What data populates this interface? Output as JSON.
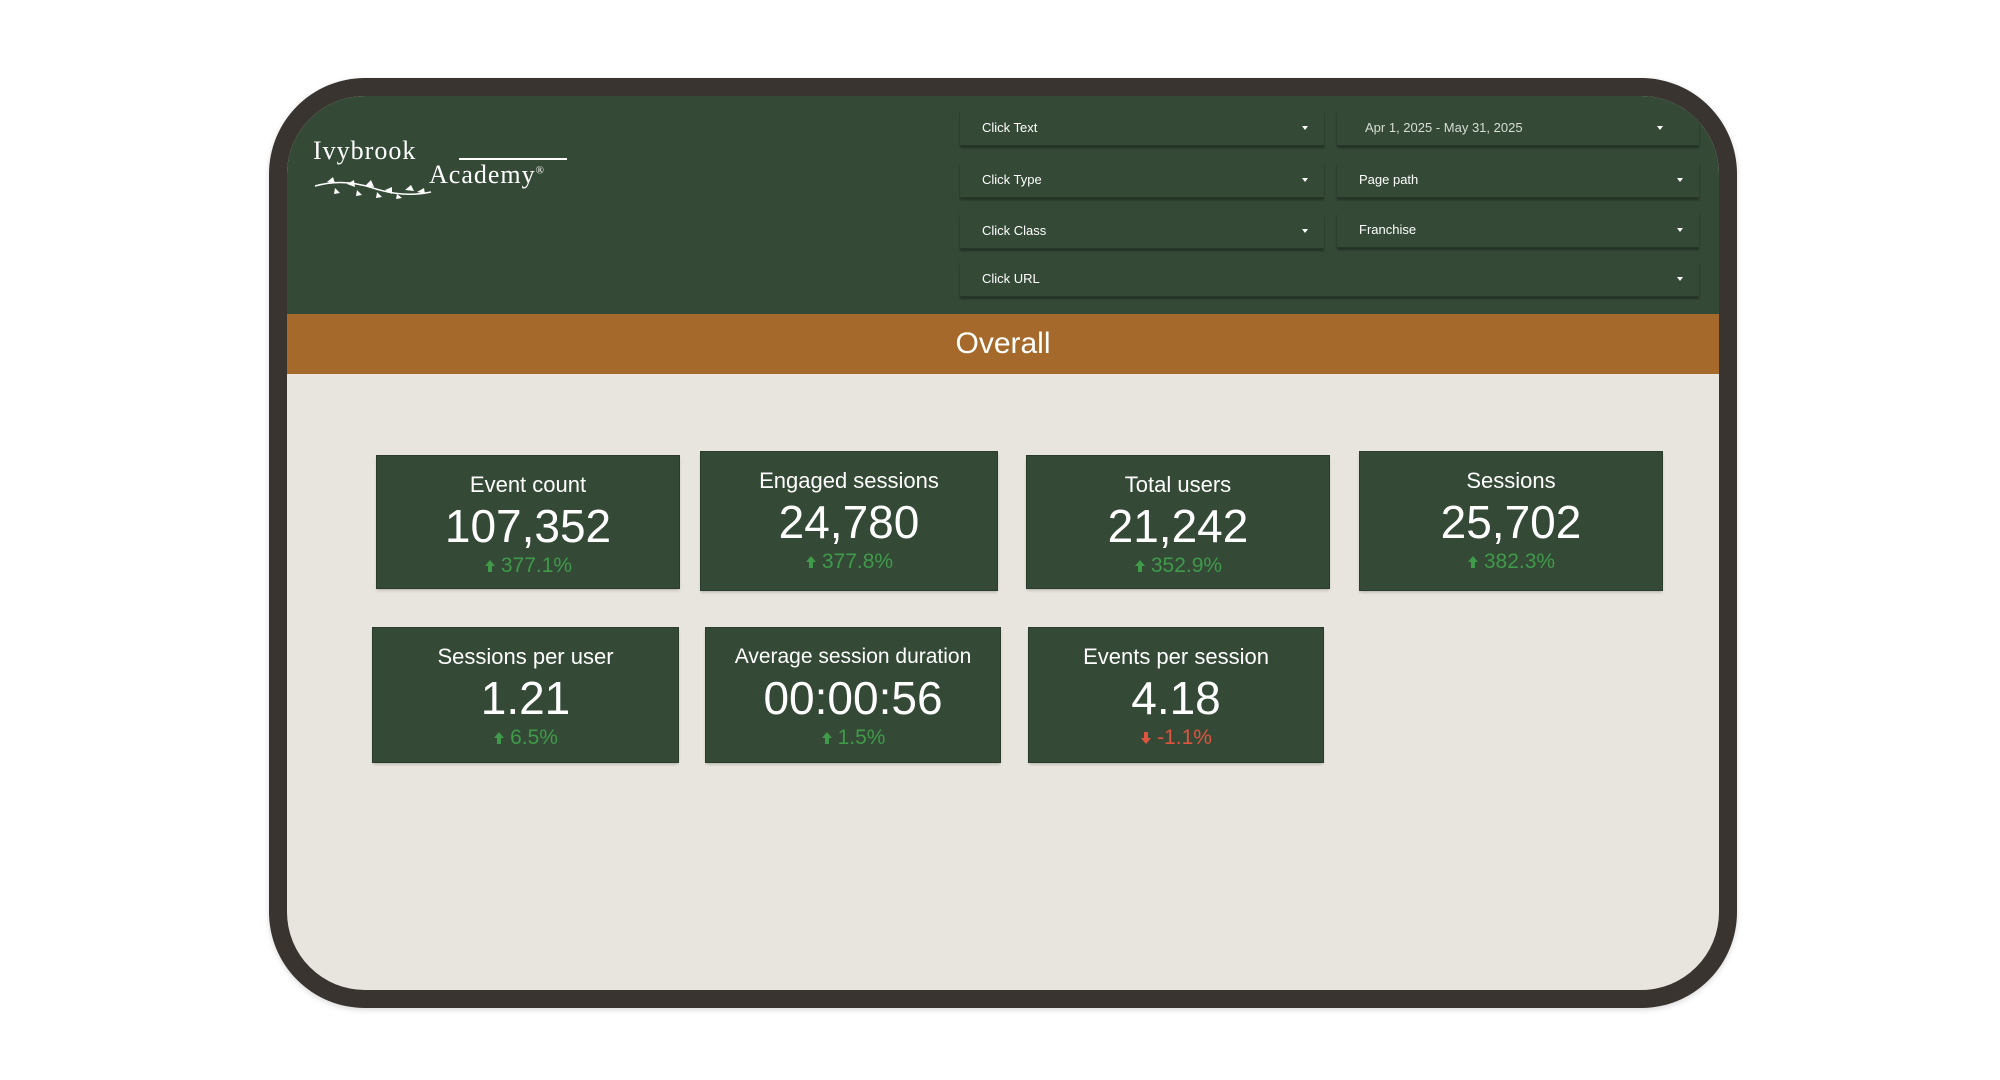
{
  "logo": {
    "line1": "Ivybrook",
    "line2": "Academy",
    "mark": "®"
  },
  "filters": {
    "click_text": "Click Text",
    "click_type": "Click Type",
    "click_class": "Click Class",
    "click_url": "Click URL",
    "date_range": "Apr 1, 2025 - May 31, 2025",
    "page_path": "Page path",
    "franchise": "Franchise"
  },
  "section_title": "Overall",
  "metrics": [
    {
      "title": "Event count",
      "value": "107,352",
      "delta": "377.1%",
      "direction": "up"
    },
    {
      "title": "Engaged sessions",
      "value": "24,780",
      "delta": "377.8%",
      "direction": "up"
    },
    {
      "title": "Total users",
      "value": "21,242",
      "delta": "352.9%",
      "direction": "up"
    },
    {
      "title": "Sessions",
      "value": "25,702",
      "delta": "382.3%",
      "direction": "up"
    },
    {
      "title": "Sessions per user",
      "value": "1.21",
      "delta": "6.5%",
      "direction": "up"
    },
    {
      "title": "Average session duration",
      "value": "00:00:56",
      "delta": "1.5%",
      "direction": "up"
    },
    {
      "title": "Events per session",
      "value": "4.18",
      "delta": "-1.1%",
      "direction": "down"
    }
  ],
  "colors": {
    "header_green": "#344a36",
    "accent_band": "#a56a2b",
    "page_background": "#e8e4de",
    "positive": "#3f9a4a",
    "negative": "#e0543f"
  },
  "icons": {
    "dropdown": "caret-down-icon",
    "up": "arrow-up-icon",
    "down": "arrow-down-icon"
  }
}
